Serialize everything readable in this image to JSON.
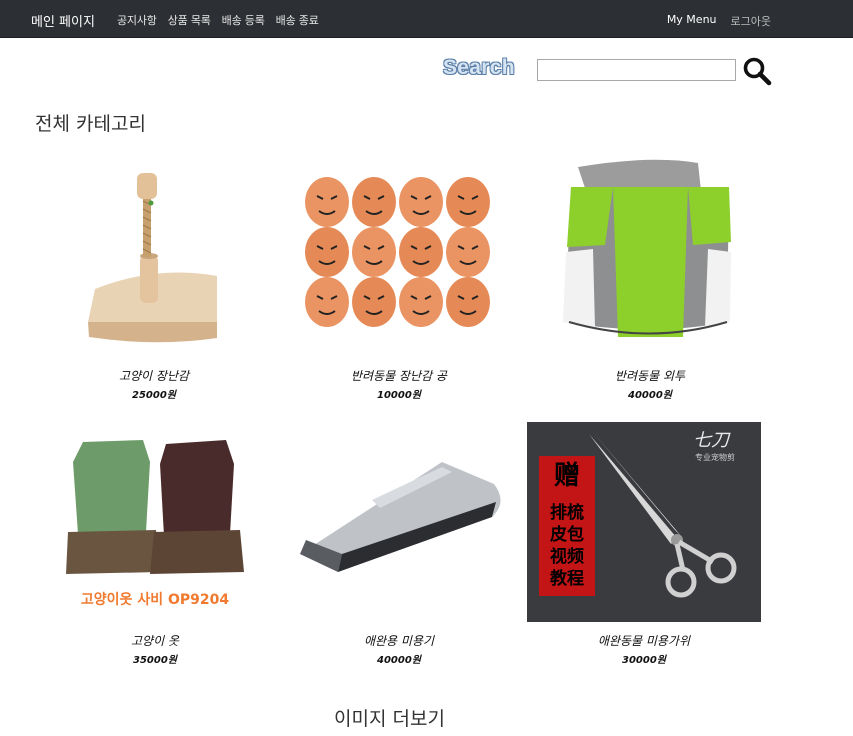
{
  "navbar": {
    "brand": "메인 페이지",
    "links": [
      "공지사항",
      "상품 목록",
      "배송 등록",
      "배송 종료"
    ],
    "my_menu": "My Menu",
    "logout": "로그아웃"
  },
  "search": {
    "label": "Search",
    "value": "",
    "button_icon": "search-icon"
  },
  "category_title": "전체 카테고리",
  "products": [
    {
      "name": "고양이 장난감",
      "price": "25000원",
      "image": "cat-toy-scratch-post"
    },
    {
      "name": "반려동물 장난감 공",
      "price": "10000원",
      "image": "egg-face-balls"
    },
    {
      "name": "반려동물 외투",
      "price": "40000원",
      "image": "green-pet-coat"
    },
    {
      "name": "고양이 옷",
      "price": "35000원",
      "image": "cat-clothes",
      "image_caption": "고양이옷 사비 OP9204"
    },
    {
      "name": "애완용 미용기",
      "price": "40000원",
      "image": "pet-clipper"
    },
    {
      "name": "애완동물 미용가위",
      "price": "30000원",
      "image": "grooming-scissors",
      "image_text": [
        "赠",
        "排梳",
        "皮包",
        "视频",
        "教程"
      ],
      "image_brand": "专业宠物剪"
    }
  ],
  "more_label": "이미지 더보기",
  "colors": {
    "navbar_bg": "#2c2f33",
    "search_label": "#5a7fa8"
  }
}
